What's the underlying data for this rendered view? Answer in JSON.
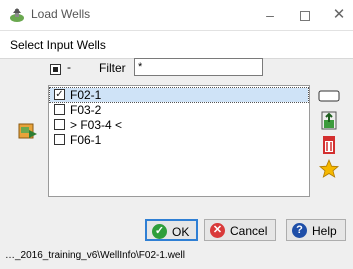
{
  "window": {
    "title": "Load Wells",
    "minimize_glyph": "–",
    "close_glyph": "✕"
  },
  "header": {
    "label": "Select Input Wells"
  },
  "toolbar": {
    "select_toggle_glyph": "-",
    "filter_label": "Filter",
    "filter_value": "*"
  },
  "wells": [
    {
      "label": "F02-1",
      "checked": true,
      "selected": true
    },
    {
      "label": "F03-2",
      "checked": false,
      "selected": false
    },
    {
      "label": "> F03-4 <",
      "checked": false,
      "selected": false
    },
    {
      "label": "F06-1",
      "checked": false,
      "selected": false
    }
  ],
  "side_buttons": {
    "left": "add-from-file-icon",
    "right": [
      "edit-icon",
      "export-icon",
      "delete-icon",
      "star-icon"
    ]
  },
  "buttons": {
    "ok": "OK",
    "cancel": "Cancel",
    "help": "Help"
  },
  "status_text": "…_2016_training_v6\\WellInfo\\F02-1.well",
  "colors": {
    "selection": "#cfe3f7",
    "ok_icon": "#2e9e3b",
    "cancel_icon": "#d93a3a",
    "help_icon": "#1f4fa8"
  }
}
